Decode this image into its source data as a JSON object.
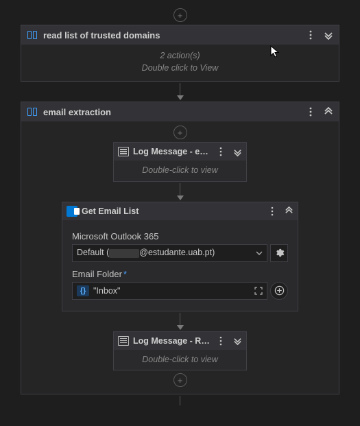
{
  "blocks": {
    "trusted": {
      "title": "read list of trusted domains",
      "action_count": "2 action(s)",
      "hint": "Double click to View"
    },
    "email": {
      "title": "email extraction"
    }
  },
  "log1": {
    "title": "Log Message - extr…",
    "hint": "Double-click to view"
  },
  "getEmail": {
    "title": "Get Email List",
    "account_label": "Microsoft Outlook 365",
    "account_prefix": "Default (",
    "account_suffix": "@estudante.uab.pt)",
    "folder_label": "Email Folder",
    "folder_value": "\"Inbox\""
  },
  "log2": {
    "title": "Log Message - Rep…",
    "hint": "Double-click to view"
  },
  "glyphs": {
    "plus": "+",
    "braces": "{}"
  }
}
